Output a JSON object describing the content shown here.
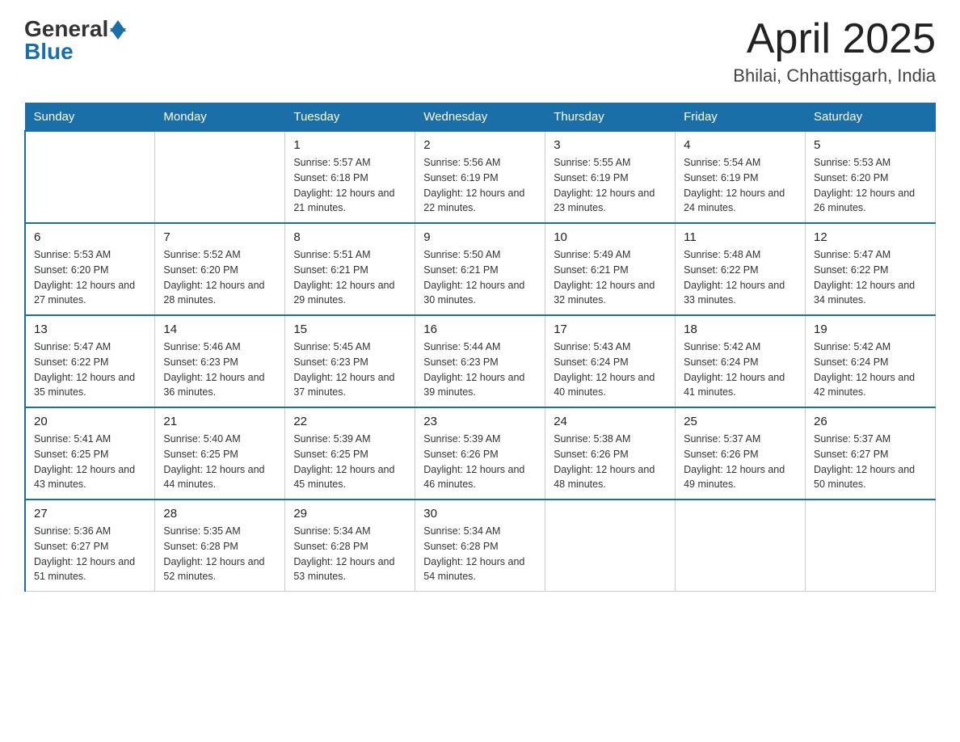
{
  "header": {
    "logo": {
      "general": "General",
      "blue": "Blue"
    },
    "title": "April 2025",
    "location": "Bhilai, Chhattisgarh, India"
  },
  "weekdays": [
    "Sunday",
    "Monday",
    "Tuesday",
    "Wednesday",
    "Thursday",
    "Friday",
    "Saturday"
  ],
  "weeks": [
    [
      {
        "day": "",
        "sunrise": "",
        "sunset": "",
        "daylight": ""
      },
      {
        "day": "",
        "sunrise": "",
        "sunset": "",
        "daylight": ""
      },
      {
        "day": "1",
        "sunrise": "Sunrise: 5:57 AM",
        "sunset": "Sunset: 6:18 PM",
        "daylight": "Daylight: 12 hours and 21 minutes."
      },
      {
        "day": "2",
        "sunrise": "Sunrise: 5:56 AM",
        "sunset": "Sunset: 6:19 PM",
        "daylight": "Daylight: 12 hours and 22 minutes."
      },
      {
        "day": "3",
        "sunrise": "Sunrise: 5:55 AM",
        "sunset": "Sunset: 6:19 PM",
        "daylight": "Daylight: 12 hours and 23 minutes."
      },
      {
        "day": "4",
        "sunrise": "Sunrise: 5:54 AM",
        "sunset": "Sunset: 6:19 PM",
        "daylight": "Daylight: 12 hours and 24 minutes."
      },
      {
        "day": "5",
        "sunrise": "Sunrise: 5:53 AM",
        "sunset": "Sunset: 6:20 PM",
        "daylight": "Daylight: 12 hours and 26 minutes."
      }
    ],
    [
      {
        "day": "6",
        "sunrise": "Sunrise: 5:53 AM",
        "sunset": "Sunset: 6:20 PM",
        "daylight": "Daylight: 12 hours and 27 minutes."
      },
      {
        "day": "7",
        "sunrise": "Sunrise: 5:52 AM",
        "sunset": "Sunset: 6:20 PM",
        "daylight": "Daylight: 12 hours and 28 minutes."
      },
      {
        "day": "8",
        "sunrise": "Sunrise: 5:51 AM",
        "sunset": "Sunset: 6:21 PM",
        "daylight": "Daylight: 12 hours and 29 minutes."
      },
      {
        "day": "9",
        "sunrise": "Sunrise: 5:50 AM",
        "sunset": "Sunset: 6:21 PM",
        "daylight": "Daylight: 12 hours and 30 minutes."
      },
      {
        "day": "10",
        "sunrise": "Sunrise: 5:49 AM",
        "sunset": "Sunset: 6:21 PM",
        "daylight": "Daylight: 12 hours and 32 minutes."
      },
      {
        "day": "11",
        "sunrise": "Sunrise: 5:48 AM",
        "sunset": "Sunset: 6:22 PM",
        "daylight": "Daylight: 12 hours and 33 minutes."
      },
      {
        "day": "12",
        "sunrise": "Sunrise: 5:47 AM",
        "sunset": "Sunset: 6:22 PM",
        "daylight": "Daylight: 12 hours and 34 minutes."
      }
    ],
    [
      {
        "day": "13",
        "sunrise": "Sunrise: 5:47 AM",
        "sunset": "Sunset: 6:22 PM",
        "daylight": "Daylight: 12 hours and 35 minutes."
      },
      {
        "day": "14",
        "sunrise": "Sunrise: 5:46 AM",
        "sunset": "Sunset: 6:23 PM",
        "daylight": "Daylight: 12 hours and 36 minutes."
      },
      {
        "day": "15",
        "sunrise": "Sunrise: 5:45 AM",
        "sunset": "Sunset: 6:23 PM",
        "daylight": "Daylight: 12 hours and 37 minutes."
      },
      {
        "day": "16",
        "sunrise": "Sunrise: 5:44 AM",
        "sunset": "Sunset: 6:23 PM",
        "daylight": "Daylight: 12 hours and 39 minutes."
      },
      {
        "day": "17",
        "sunrise": "Sunrise: 5:43 AM",
        "sunset": "Sunset: 6:24 PM",
        "daylight": "Daylight: 12 hours and 40 minutes."
      },
      {
        "day": "18",
        "sunrise": "Sunrise: 5:42 AM",
        "sunset": "Sunset: 6:24 PM",
        "daylight": "Daylight: 12 hours and 41 minutes."
      },
      {
        "day": "19",
        "sunrise": "Sunrise: 5:42 AM",
        "sunset": "Sunset: 6:24 PM",
        "daylight": "Daylight: 12 hours and 42 minutes."
      }
    ],
    [
      {
        "day": "20",
        "sunrise": "Sunrise: 5:41 AM",
        "sunset": "Sunset: 6:25 PM",
        "daylight": "Daylight: 12 hours and 43 minutes."
      },
      {
        "day": "21",
        "sunrise": "Sunrise: 5:40 AM",
        "sunset": "Sunset: 6:25 PM",
        "daylight": "Daylight: 12 hours and 44 minutes."
      },
      {
        "day": "22",
        "sunrise": "Sunrise: 5:39 AM",
        "sunset": "Sunset: 6:25 PM",
        "daylight": "Daylight: 12 hours and 45 minutes."
      },
      {
        "day": "23",
        "sunrise": "Sunrise: 5:39 AM",
        "sunset": "Sunset: 6:26 PM",
        "daylight": "Daylight: 12 hours and 46 minutes."
      },
      {
        "day": "24",
        "sunrise": "Sunrise: 5:38 AM",
        "sunset": "Sunset: 6:26 PM",
        "daylight": "Daylight: 12 hours and 48 minutes."
      },
      {
        "day": "25",
        "sunrise": "Sunrise: 5:37 AM",
        "sunset": "Sunset: 6:26 PM",
        "daylight": "Daylight: 12 hours and 49 minutes."
      },
      {
        "day": "26",
        "sunrise": "Sunrise: 5:37 AM",
        "sunset": "Sunset: 6:27 PM",
        "daylight": "Daylight: 12 hours and 50 minutes."
      }
    ],
    [
      {
        "day": "27",
        "sunrise": "Sunrise: 5:36 AM",
        "sunset": "Sunset: 6:27 PM",
        "daylight": "Daylight: 12 hours and 51 minutes."
      },
      {
        "day": "28",
        "sunrise": "Sunrise: 5:35 AM",
        "sunset": "Sunset: 6:28 PM",
        "daylight": "Daylight: 12 hours and 52 minutes."
      },
      {
        "day": "29",
        "sunrise": "Sunrise: 5:34 AM",
        "sunset": "Sunset: 6:28 PM",
        "daylight": "Daylight: 12 hours and 53 minutes."
      },
      {
        "day": "30",
        "sunrise": "Sunrise: 5:34 AM",
        "sunset": "Sunset: 6:28 PM",
        "daylight": "Daylight: 12 hours and 54 minutes."
      },
      {
        "day": "",
        "sunrise": "",
        "sunset": "",
        "daylight": ""
      },
      {
        "day": "",
        "sunrise": "",
        "sunset": "",
        "daylight": ""
      },
      {
        "day": "",
        "sunrise": "",
        "sunset": "",
        "daylight": ""
      }
    ]
  ]
}
